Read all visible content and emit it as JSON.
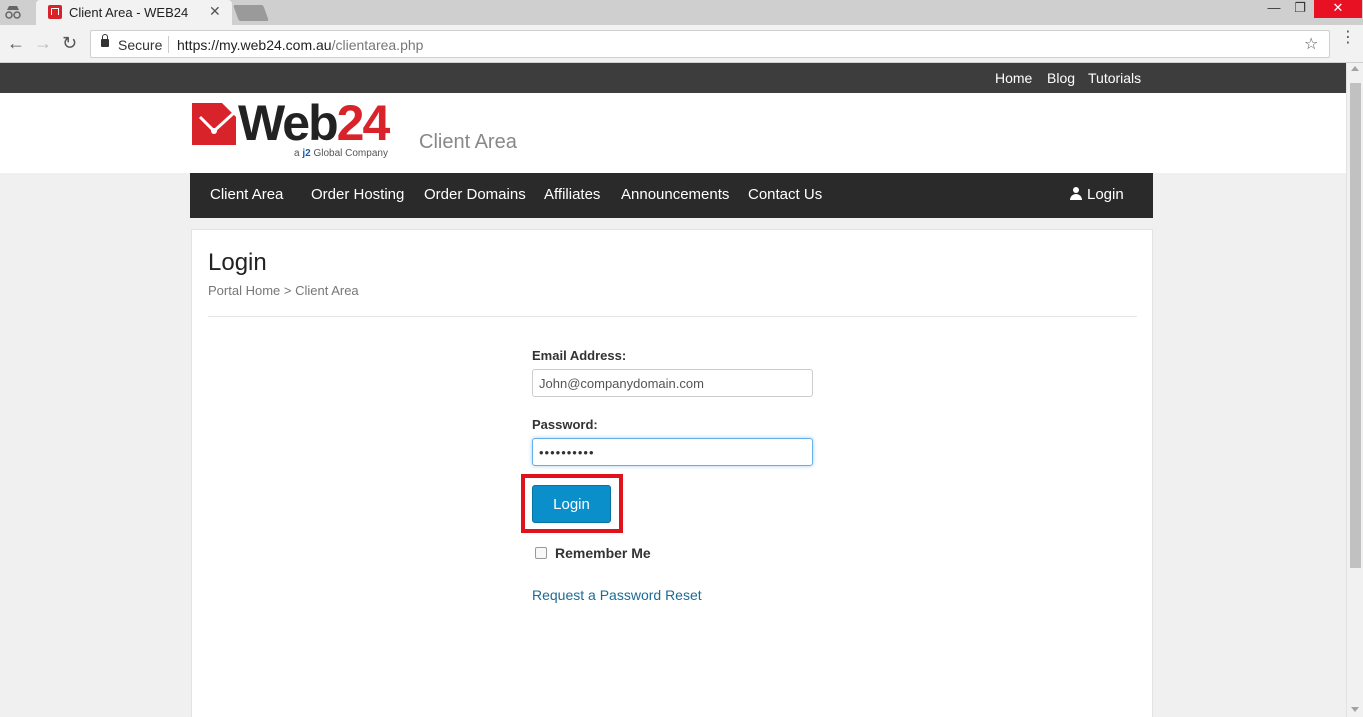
{
  "browser": {
    "tab_title": "Client Area - WEB24",
    "tab_close": "✕",
    "secure_label": "Secure",
    "url_host": "https://my.web24.com.au",
    "url_path": "/clientarea.php"
  },
  "topbar": {
    "links": [
      "Home",
      "Blog",
      "Tutorials"
    ]
  },
  "header": {
    "logo_text_main": "Web",
    "logo_text_num": "24",
    "logo_sub_prefix": "a ",
    "logo_sub_brand": "j2",
    "logo_sub_suffix": " Global Company",
    "title": "Client Area"
  },
  "nav": {
    "items": [
      "Client Area",
      "Order Hosting",
      "Order Domains",
      "Affiliates",
      "Announcements",
      "Contact Us"
    ],
    "login": "Login"
  },
  "page": {
    "title": "Login",
    "breadcrumb": "Portal Home > Client Area",
    "email_label": "Email Address:",
    "email_value": "John@companydomain.com",
    "password_label": "Password:",
    "password_value": "••••••••••",
    "login_button": "Login",
    "remember_label": "Remember Me",
    "reset_link": "Request a Password Reset"
  },
  "colors": {
    "brand_red": "#d9232a",
    "button_blue": "#0a8fcb",
    "highlight_red": "#e0121c"
  }
}
